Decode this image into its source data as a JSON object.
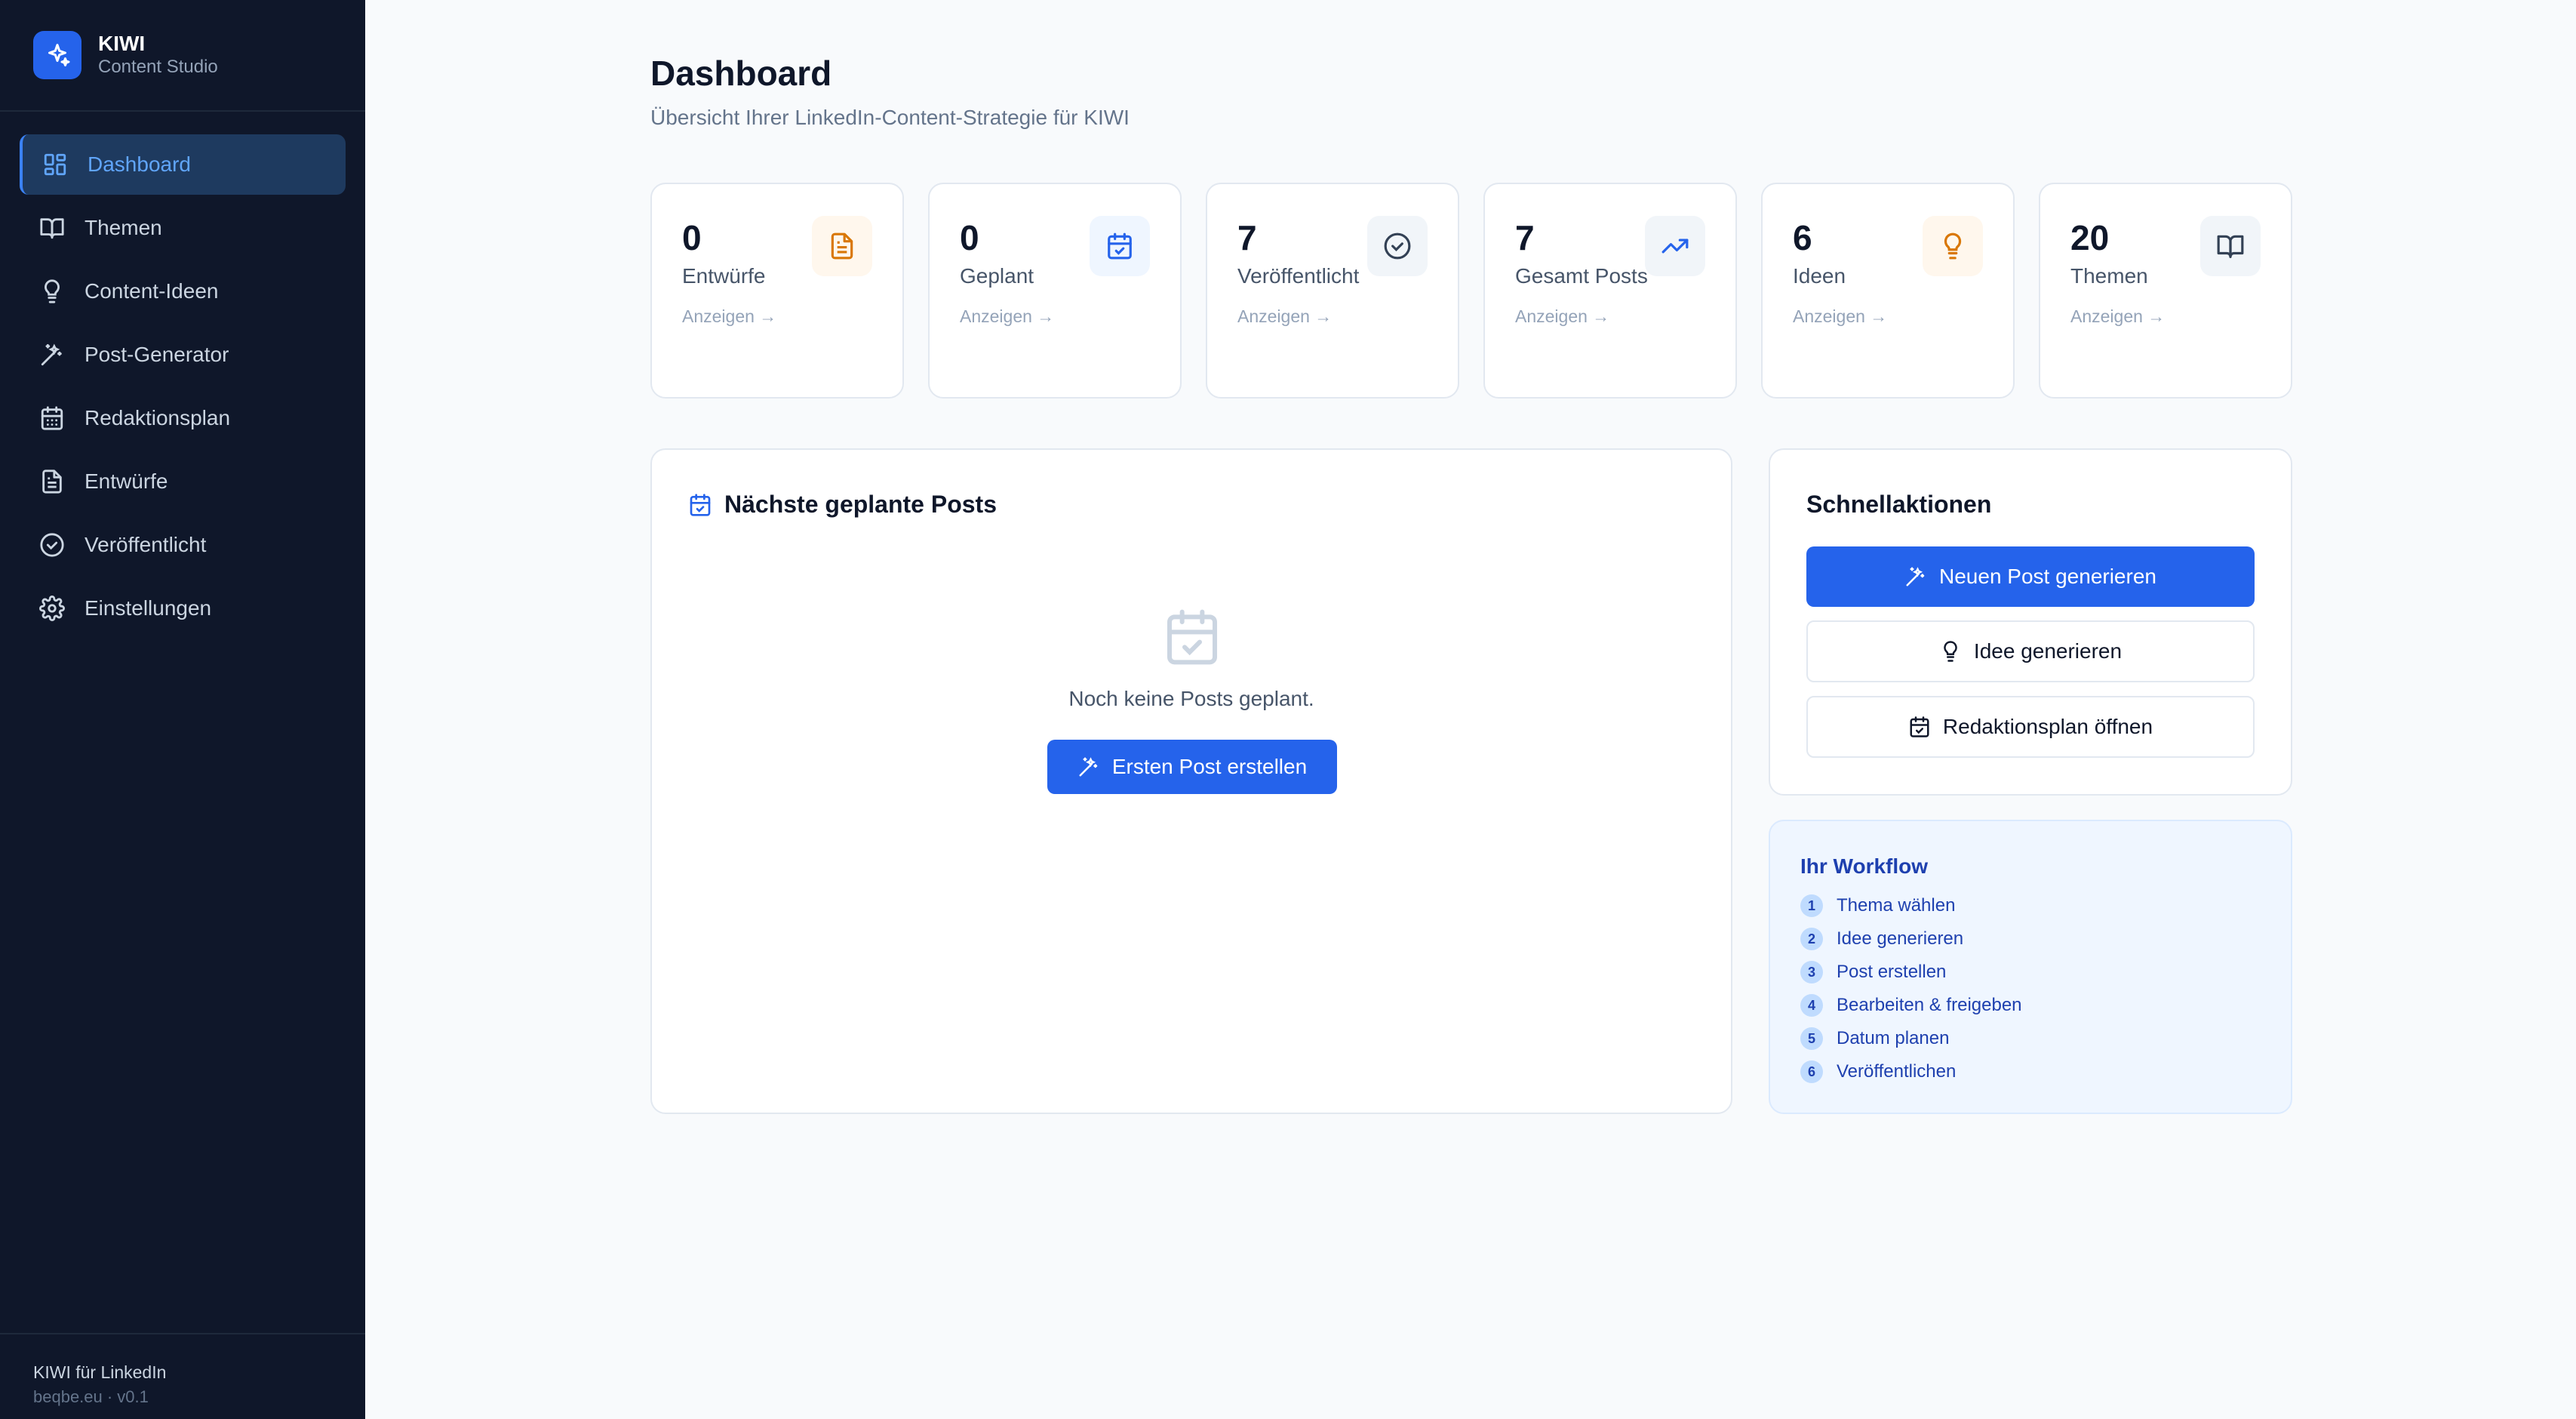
{
  "brand": {
    "title": "KIWI",
    "subtitle": "Content Studio"
  },
  "nav": [
    {
      "label": "Dashboard",
      "icon": "dashboard-icon",
      "active": true
    },
    {
      "label": "Themen",
      "icon": "book-icon"
    },
    {
      "label": "Content-Ideen",
      "icon": "lightbulb-icon"
    },
    {
      "label": "Post-Generator",
      "icon": "wand-icon"
    },
    {
      "label": "Redaktionsplan",
      "icon": "calendar-icon"
    },
    {
      "label": "Entwürfe",
      "icon": "file-icon"
    },
    {
      "label": "Veröffentlicht",
      "icon": "check-circle-icon"
    },
    {
      "label": "Einstellungen",
      "icon": "gear-icon"
    }
  ],
  "footer": {
    "line1": "KIWI für LinkedIn",
    "line2": "beqbe.eu · v0.1"
  },
  "page": {
    "title": "Dashboard",
    "subtitle": "Übersicht Ihrer LinkedIn-Content-Strategie für KIWI"
  },
  "stats": [
    {
      "value": "0",
      "label": "Entwürfe",
      "link": "Anzeigen →",
      "icon": "file-icon",
      "color": "#d97706",
      "bg": "#fff7ed"
    },
    {
      "value": "0",
      "label": "Geplant",
      "link": "Anzeigen →",
      "icon": "calendar-check-icon",
      "color": "#2563eb",
      "bg": "#eff6ff"
    },
    {
      "value": "7",
      "label": "Veröffentlicht",
      "link": "Anzeigen →",
      "icon": "check-circle-icon",
      "color": "#334155",
      "bg": "#f1f5f9"
    },
    {
      "value": "7",
      "label": "Gesamt Posts",
      "link": "Anzeigen →",
      "icon": "trending-up-icon",
      "color": "#2563eb",
      "bg": "#f1f5f9"
    },
    {
      "value": "6",
      "label": "Ideen",
      "link": "Anzeigen →",
      "icon": "lightbulb-icon",
      "color": "#d97706",
      "bg": "#fff7ed"
    },
    {
      "value": "20",
      "label": "Themen",
      "link": "Anzeigen →",
      "icon": "book-icon",
      "color": "#334155",
      "bg": "#f1f5f9"
    }
  ],
  "scheduled": {
    "title": "Nächste geplante Posts",
    "empty_text": "Noch keine Posts geplant.",
    "button": "Ersten Post erstellen"
  },
  "quick": {
    "title": "Schnellaktionen",
    "actions": [
      {
        "label": "Neuen Post generieren",
        "icon": "wand-icon"
      },
      {
        "label": "Idee generieren",
        "icon": "lightbulb-icon"
      },
      {
        "label": "Redaktionsplan öffnen",
        "icon": "calendar-check-icon"
      }
    ]
  },
  "workflow": {
    "title": "Ihr Workflow",
    "steps": [
      {
        "n": "1",
        "label": "Thema wählen"
      },
      {
        "n": "2",
        "label": "Idee generieren"
      },
      {
        "n": "3",
        "label": "Post erstellen"
      },
      {
        "n": "4",
        "label": "Bearbeiten & freigeben"
      },
      {
        "n": "5",
        "label": "Datum planen"
      },
      {
        "n": "6",
        "label": "Veröffentlichen"
      }
    ]
  },
  "colors": {
    "sidebar": "#0f172a",
    "accent": "#2563eb",
    "active_nav": "#60a5fa"
  }
}
